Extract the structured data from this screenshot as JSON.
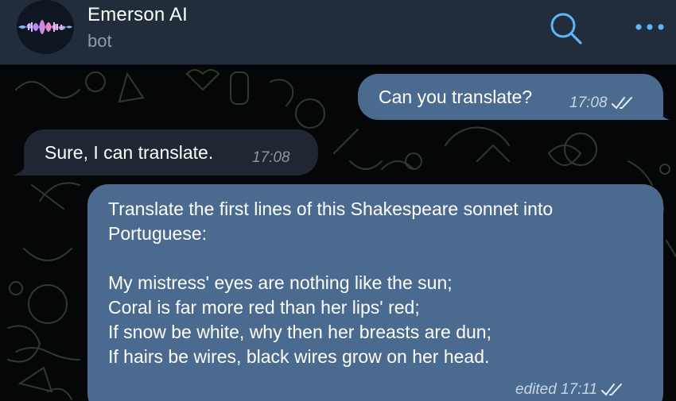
{
  "header": {
    "title": "Emerson AI",
    "subtitle": "bot",
    "avatar_icon": "voice-waveform-icon",
    "search_icon": "search-icon",
    "more_icon": "more-dots-icon"
  },
  "messages": [
    {
      "direction": "outgoing",
      "text": "Can you translate?",
      "time": "17:08",
      "status": "read"
    },
    {
      "direction": "incoming",
      "text": "Sure, I can translate.",
      "time": "17:08"
    },
    {
      "direction": "outgoing",
      "lines": [
        "Translate the first lines of this Shakespeare sonnet into",
        "Portuguese:",
        "",
        "My mistress' eyes are nothing like the sun;",
        "Coral is far more red than her lips' red;",
        "If snow be white, why then her breasts are dun;",
        "If hairs be wires, black wires grow on her head."
      ],
      "time": "edited 17:11",
      "status": "read"
    }
  ],
  "colors": {
    "header_bg": "#212d3b",
    "outgoing_bubble": "#4b6a8f",
    "incoming_bubble": "#1e2732",
    "accent": "#5eb5f7"
  }
}
